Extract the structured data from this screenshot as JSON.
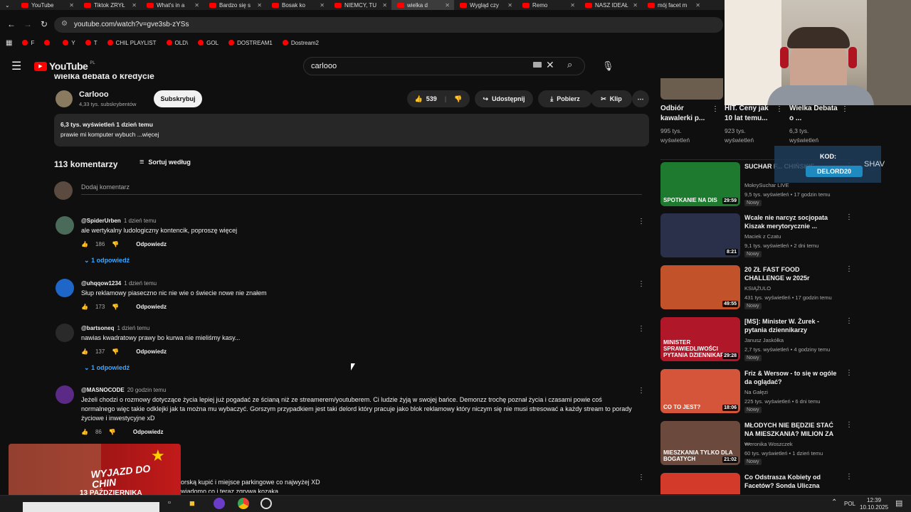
{
  "browser": {
    "tabs": [
      {
        "label": "YouTube",
        "active": false
      },
      {
        "label": "Tiktok ZRYŁ",
        "active": false
      },
      {
        "label": "What's in a",
        "active": false
      },
      {
        "label": "Bardzo się s",
        "active": false
      },
      {
        "label": "Bosak ko",
        "active": false
      },
      {
        "label": "NIEMCY, TU",
        "active": false
      },
      {
        "label": "wielka d",
        "active": true
      },
      {
        "label": "Wygląd czy",
        "active": false
      },
      {
        "label": "Remo",
        "active": false
      },
      {
        "label": "NASZ IDEAŁ",
        "active": false
      },
      {
        "label": "mój facet m",
        "active": false
      }
    ],
    "url": "youtube.com/watch?v=gve3sb-zYSs",
    "bookmarks": [
      {
        "label": "F"
      },
      {
        "label": ""
      },
      {
        "label": "Y"
      },
      {
        "label": "T"
      },
      {
        "label": "CHIL PLAYLIST"
      },
      {
        "label": "OLD\\"
      },
      {
        "label": "GOL"
      },
      {
        "label": "DOSTREAM1"
      },
      {
        "label": "Dostream2"
      }
    ]
  },
  "youtube": {
    "logo_text": "YouTube",
    "logo_region": "PL",
    "search_value": "carlooo",
    "video_title_partial": "wielka debata o kredycie",
    "channel": {
      "name": "Carlooo",
      "subscribers": "4,33 tys. subskrybentów",
      "subscribe_label": "Subskrybuj"
    },
    "actions": {
      "likes": "539",
      "share": "Udostępnij",
      "download": "Pobierz",
      "clip": "Klip"
    },
    "description": {
      "stats": "6,3 tys. wyświetleń  1 dzień temu",
      "text": "prawie mi komputer wybuch ...więcej"
    },
    "comments_header": {
      "count_label": "113 komentarzy",
      "sort_label": "Sortuj według"
    },
    "add_comment_placeholder": "Dodaj komentarz",
    "comments": [
      {
        "author": "@SpiderUrben",
        "time": "1 dzień temu",
        "text": "ale wertykalny ludologiczny kontencik, poproszę więcej",
        "likes": "186",
        "reply_label": "Odpowiedz",
        "replies": "1 odpowiedź"
      },
      {
        "author": "@uhqqow1234",
        "time": "1 dzień temu",
        "text": "Słup reklamowy piaseczno nic nie wie o świecie nowe nie znałem",
        "likes": "173",
        "reply_label": "Odpowiedz",
        "replies": ""
      },
      {
        "author": "@bartsoneq",
        "time": "1 dzień temu",
        "text": "nawias kwadratowy prawy bo kurwa nie mieliśmy kasy...",
        "likes": "137",
        "reply_label": "Odpowiedz",
        "replies": "1 odpowiedź"
      },
      {
        "author": "@MASNOCODE",
        "time": "20 godzin temu",
        "text": "Jeżeli chodzi o rozmowy dotyczące życia lepiej już pogadać ze ścianą niż ze streamerem/youtuberem. Ci ludzie żyją w swojej bańce. Demonzz trochę poznał życia i czasami powie coś normalnego więc takie odklejki jak ta można mu wybaczyć. Gorszym przypadkiem jest taki delord który pracuje jako blok reklamowy który niczym się nie musi stresować a każdy stream to porady życiowe i inwestycyjne xD",
        "likes": "86",
        "reply_label": "Odpowiedz",
        "replies": "2 odpowiedzi"
      }
    ],
    "partial_comment": {
      "line1": "orską kupić i miejsce parkingowe co najwyżej XD",
      "line2": "wiadomo co i teraz zgrywa kozaka"
    },
    "sidebar_top": [
      {
        "title": "Odbiór kawalerki p...",
        "meta": "995 tys. wyświetleń"
      },
      {
        "title": "HIT. Ceny jak 10 lat temu...",
        "meta": "923 tys. wyświetleń"
      },
      {
        "title": "Wielka Debata o ...",
        "meta": "6,3 tys. wyświetleń"
      }
    ],
    "recommendations": [
      {
        "title": "SUCHAR F... CHIŃSKIE...",
        "channel": "MokrySuchar LIVE",
        "meta": "9,5 tys. wyświetleń • 17 godzin temu",
        "duration": "29:59",
        "badge": "Nowy",
        "thumb_text": "SPOTKANIE NA DIS",
        "thumb_color": "#1e7a2e"
      },
      {
        "title": "Wcale nie narcyz socjopata Kiszak merytorycznie ...",
        "channel": "Maciek z Czatu",
        "meta": "9,1 tys. wyświetleń • 2 dni temu",
        "duration": "8:21",
        "badge": "Nowy",
        "thumb_text": "",
        "thumb_color": "#2a2f4a"
      },
      {
        "title": "20 ZŁ FAST FOOD CHALLENGE w 2025r",
        "channel": "KSIĄŻULO",
        "meta": "431 tys. wyświetleń • 17 godzin temu",
        "duration": "49:55",
        "badge": "Nowy",
        "thumb_text": "",
        "thumb_color": "#c2522a"
      },
      {
        "title": "[MS]: Minister W. Żurek - pytania dziennikarzy",
        "channel": "Janusz Jaskółka",
        "meta": "2,7 tys. wyświetleń • 4 godziny temu",
        "duration": "29:28",
        "badge": "Nowy",
        "thumb_text": "MINISTER SPRAWIEDLIWOŚCI PYTANIA DZIENNIKARZY",
        "thumb_color": "#b0182a"
      },
      {
        "title": "Friz & Wersow - to się w ogóle da oglądać?",
        "channel": "Na Gałęzi",
        "meta": "225 tys. wyświetleń • 6 dni temu",
        "duration": "18:06",
        "badge": "Nowy",
        "thumb_text": "CO TO JEST?",
        "thumb_color": "#d4553a"
      },
      {
        "title": "MŁODYCH NIE BĘDZIE STAĆ NA MIESZKANIA? MILION ZA ...",
        "channel": "Weronika Woszczek",
        "meta": "60 tys. wyświetleń • 1 dzień temu",
        "duration": "21:02",
        "badge": "Nowy",
        "thumb_text": "MIESZKANIA TYLKO DLA BOGATYCH",
        "thumb_color": "#6b4a3d"
      },
      {
        "title": "Co Odstrasza Kobiety od Facetów? Sonda Uliczna",
        "channel": "",
        "meta": "",
        "duration": "",
        "badge": "",
        "thumb_text": "CO ODSTRASZA",
        "thumb_color": "#d43a2a"
      }
    ]
  },
  "overlay": {
    "promo_code_label": "KOD:",
    "promo_code": "DELORD20",
    "promo_brand": "SHAV",
    "banner_title": "WYJAZD DO CHIN",
    "banner_date": "13 PAŹDZIERNIKA"
  },
  "taskbar": {
    "lang": "POL",
    "time": "12:39",
    "date": "10.10.2025"
  },
  "colors": {
    "bg": "#0f0f0f",
    "accent": "#ff0000",
    "link": "#3ea6ff"
  }
}
